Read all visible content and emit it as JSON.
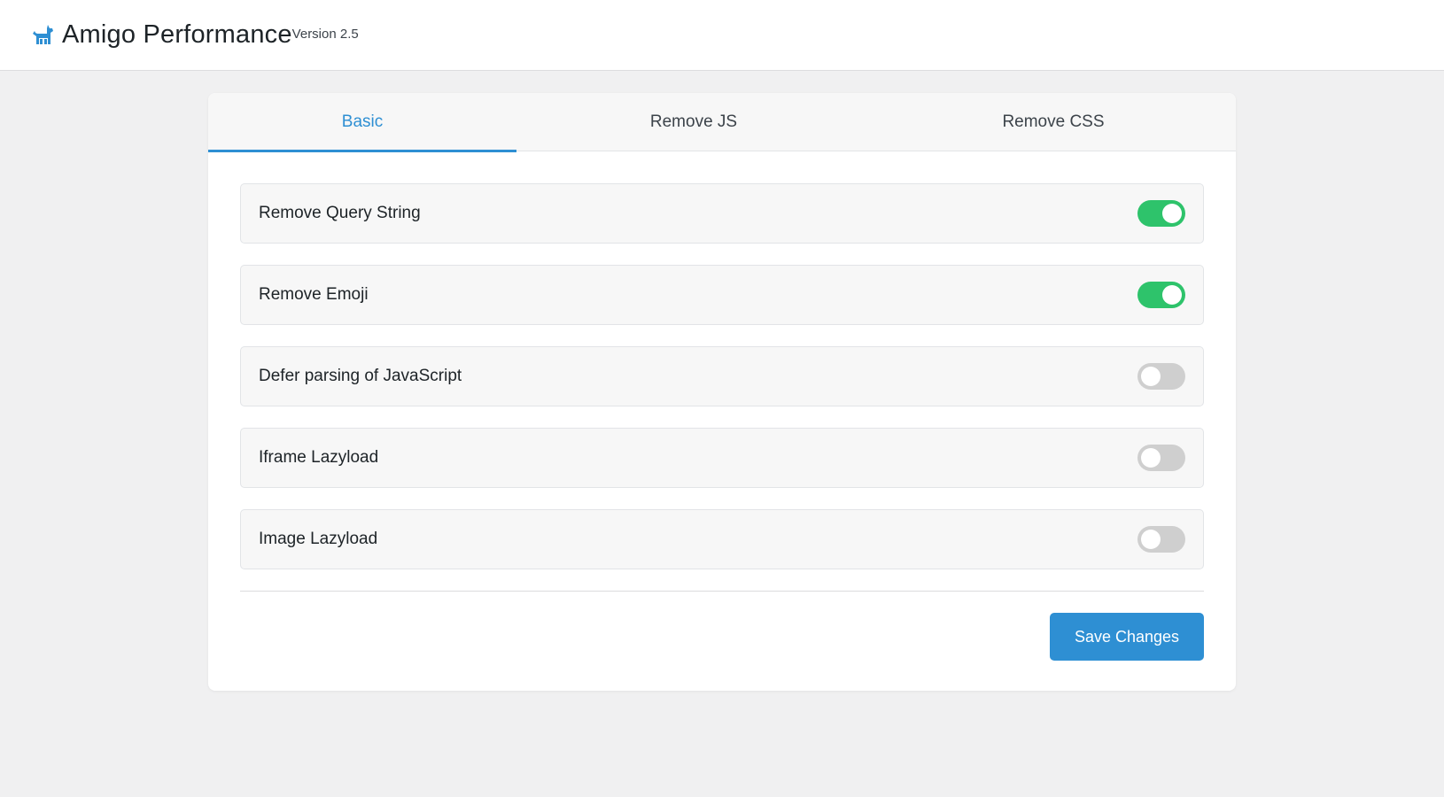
{
  "header": {
    "title": "Amigo Performance",
    "version": "Version 2.5",
    "logo_icon": "dog-icon"
  },
  "tabs": [
    {
      "label": "Basic",
      "active": true
    },
    {
      "label": "Remove JS",
      "active": false
    },
    {
      "label": "Remove CSS",
      "active": false
    }
  ],
  "settings": [
    {
      "label": "Remove Query String",
      "enabled": true
    },
    {
      "label": "Remove Emoji",
      "enabled": true
    },
    {
      "label": "Defer parsing of JavaScript",
      "enabled": false
    },
    {
      "label": "Iframe Lazyload",
      "enabled": false
    },
    {
      "label": "Image Lazyload",
      "enabled": false
    }
  ],
  "actions": {
    "save_label": "Save Changes"
  },
  "colors": {
    "accent": "#2e8fd3",
    "toggle_on": "#2ec36b",
    "toggle_off": "#cfcfcf"
  }
}
